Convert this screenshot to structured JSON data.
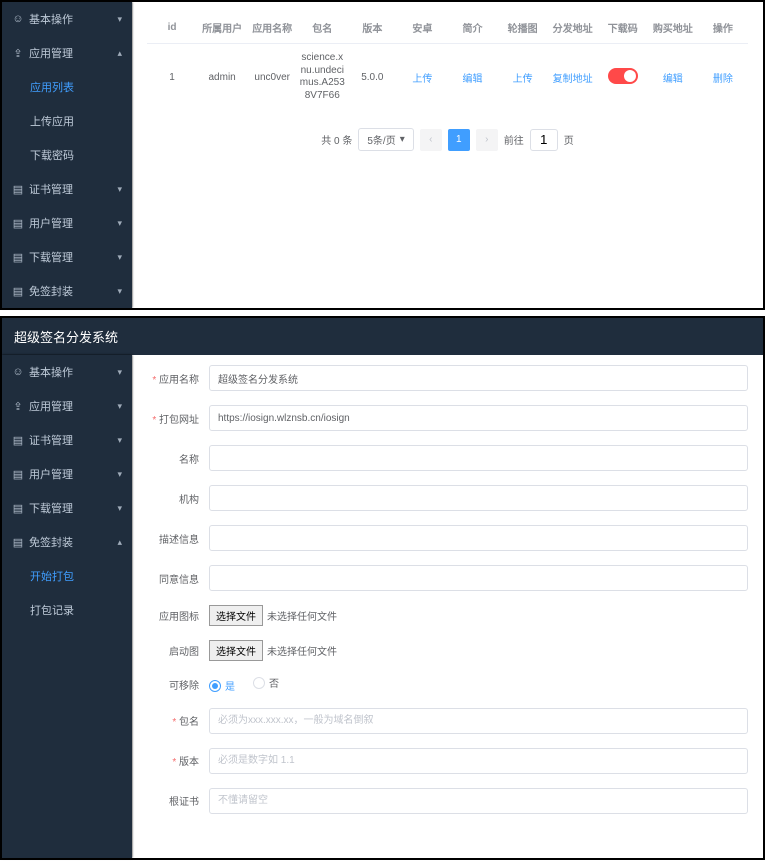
{
  "panel1": {
    "sidebar": [
      {
        "type": "group",
        "icon": "user",
        "label": "基本操作",
        "chev": "▾"
      },
      {
        "type": "group",
        "icon": "upload",
        "label": "应用管理",
        "chev": "▴"
      },
      {
        "type": "item",
        "label": "应用列表",
        "active": true
      },
      {
        "type": "item",
        "label": "上传应用"
      },
      {
        "type": "item",
        "label": "下载密码"
      },
      {
        "type": "group",
        "icon": "doc",
        "label": "证书管理",
        "chev": "▾"
      },
      {
        "type": "group",
        "icon": "doc",
        "label": "用户管理",
        "chev": "▾"
      },
      {
        "type": "group",
        "icon": "doc",
        "label": "下载管理",
        "chev": "▾"
      },
      {
        "type": "group",
        "icon": "doc",
        "label": "免签封装",
        "chev": "▾"
      }
    ],
    "table": {
      "headers": [
        "id",
        "所属用户",
        "应用名称",
        "包名",
        "版本",
        "安卓",
        "简介",
        "轮播图",
        "分发地址",
        "下载码",
        "购买地址",
        "操作"
      ],
      "rows": [
        {
          "id": "1",
          "user": "admin",
          "app": "unc0ver",
          "pkg": "science.xnu.undecimus.A2538V7F66",
          "ver": "5.0.0",
          "android": "上传",
          "intro": "编辑",
          "carousel": "上传",
          "dist": "复制地址",
          "buy": "编辑",
          "op": "删除"
        }
      ]
    },
    "pager": {
      "total": "共 0 条",
      "size": "5条/页",
      "cur": "1",
      "goto": "前往",
      "page_val": "1",
      "unit": "页"
    }
  },
  "titlebar": "超级签名分发系统",
  "panel2": {
    "sidebar": [
      {
        "type": "group",
        "icon": "user",
        "label": "基本操作",
        "chev": "▾"
      },
      {
        "type": "group",
        "icon": "upload",
        "label": "应用管理",
        "chev": "▾"
      },
      {
        "type": "group",
        "icon": "doc",
        "label": "证书管理",
        "chev": "▾"
      },
      {
        "type": "group",
        "icon": "doc",
        "label": "用户管理",
        "chev": "▾"
      },
      {
        "type": "group",
        "icon": "doc",
        "label": "下载管理",
        "chev": "▾"
      },
      {
        "type": "group",
        "icon": "doc",
        "label": "免签封装",
        "chev": "▴"
      },
      {
        "type": "item",
        "label": "开始打包",
        "active": true
      },
      {
        "type": "item",
        "label": "打包记录"
      }
    ],
    "form": {
      "app_name": {
        "label": "应用名称",
        "value": "超级签名分发系统",
        "req": true
      },
      "pack_url": {
        "label": "打包网址",
        "value": "https://iosign.wlznsb.cn/iosign",
        "req": true
      },
      "name": {
        "label": "名称",
        "value": ""
      },
      "org": {
        "label": "机构",
        "value": ""
      },
      "desc": {
        "label": "描述信息",
        "value": ""
      },
      "consent": {
        "label": "同意信息",
        "value": ""
      },
      "icon": {
        "label": "应用图标",
        "btn": "选择文件",
        "text": "未选择任何文件"
      },
      "splash": {
        "label": "启动图",
        "btn": "选择文件",
        "text": "未选择任何文件"
      },
      "removable": {
        "label": "可移除",
        "yes": "是",
        "no": "否"
      },
      "bundle": {
        "label": "包名",
        "placeholder": "必须为xxx.xxx.xx，一般为域名倒叙",
        "req": true
      },
      "version": {
        "label": "版本",
        "placeholder": "必须是数字如 1.1",
        "req": true
      },
      "cert": {
        "label": "根证书",
        "placeholder": "不懂请留空"
      }
    }
  },
  "icons": {
    "user": "☺",
    "upload": "⇪",
    "doc": "▤",
    "chev_down": "›"
  }
}
